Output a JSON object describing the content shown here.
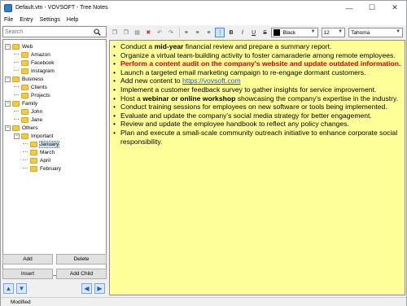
{
  "window": {
    "title": "Default.vtn - VOVSOFT - Tree Notes"
  },
  "menu": [
    "File",
    "Entry",
    "Settings",
    "Help"
  ],
  "search": {
    "placeholder": "Search"
  },
  "tree": [
    {
      "label": "Web",
      "level": 0,
      "expander": "-"
    },
    {
      "label": "Amazon",
      "level": 1
    },
    {
      "label": "Facebook",
      "level": 1
    },
    {
      "label": "Instagram",
      "level": 1
    },
    {
      "label": "Business",
      "level": 0,
      "expander": "-"
    },
    {
      "label": "Clients",
      "level": 1
    },
    {
      "label": "Projects",
      "level": 1
    },
    {
      "label": "Family",
      "level": 0,
      "expander": "-"
    },
    {
      "label": "John",
      "level": 1
    },
    {
      "label": "Jane",
      "level": 1
    },
    {
      "label": "Others",
      "level": 0,
      "expander": "-"
    },
    {
      "label": "Important",
      "level": 1,
      "expander": "-"
    },
    {
      "label": "January",
      "level": 2,
      "selected": true
    },
    {
      "label": "March",
      "level": 2
    },
    {
      "label": "April",
      "level": 2
    },
    {
      "label": "February",
      "level": 2
    }
  ],
  "buttons": {
    "add": "Add",
    "delete": "Delete",
    "insert": "Insert",
    "add_child": "Add Child"
  },
  "toolbar": {
    "color_name": "Black",
    "color_hex": "#000000",
    "font_size": "12",
    "font_name": "Tahoma"
  },
  "editor": {
    "background": "#ffff99",
    "items": [
      {
        "parts": [
          {
            "t": "Conduct a "
          },
          {
            "t": "mid-year",
            "b": true
          },
          {
            "t": " financial review and prepare a summary report."
          }
        ]
      },
      {
        "parts": [
          {
            "t": "Organize a virtual team-building activity to foster camaraderie among remote employees."
          }
        ]
      },
      {
        "parts": [
          {
            "t": "Perform a content audit on the company's website and update outdated information.",
            "red": true
          }
        ]
      },
      {
        "parts": [
          {
            "t": "Launch a targeted email marketing campaign to re-engage dormant customers."
          }
        ]
      },
      {
        "parts": [
          {
            "t": "Add new content to "
          },
          {
            "t": "https://vovsoft.com",
            "link": true
          }
        ]
      },
      {
        "parts": [
          {
            "t": "Implement a customer feedback survey to gather insights for service improvement."
          }
        ]
      },
      {
        "parts": [
          {
            "t": "Host a "
          },
          {
            "t": "webinar or online workshop",
            "b": true
          },
          {
            "t": " showcasing the company's expertise in the industry."
          }
        ]
      },
      {
        "parts": [
          {
            "t": "Conduct training sessions for employees on new software or tools being implemented."
          }
        ]
      },
      {
        "parts": [
          {
            "t": "Evaluate and update the company's social media strategy for better engagement."
          }
        ]
      },
      {
        "parts": [
          {
            "t": "Review and update the employee handbook to reflect any policy changes."
          }
        ]
      },
      {
        "parts": [
          {
            "t": "Plan and execute a small-scale community outreach initiative to enhance corporate social responsibility."
          }
        ]
      }
    ]
  },
  "status": {
    "text": "Modified"
  },
  "colors": {
    "accent": "#0078d7",
    "folder": "#f2c94c",
    "note_background": "#ffff99",
    "highlight_text": "#d80000",
    "link": "#1a58c8"
  }
}
